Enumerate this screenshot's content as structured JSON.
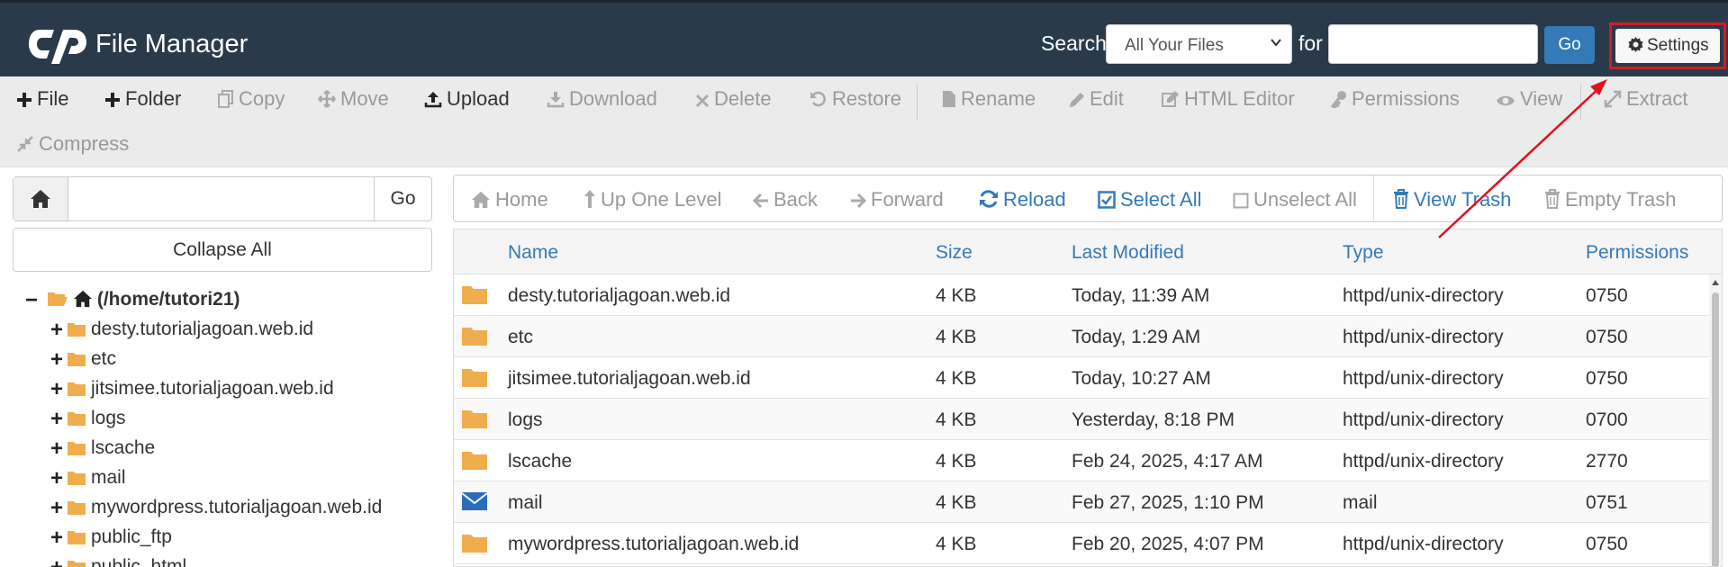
{
  "header": {
    "app_title": "File Manager",
    "search_label": "Search",
    "search_scope": "All Your Files",
    "for_label": "for",
    "search_placeholder": "",
    "go_label": "Go",
    "settings_label": "Settings"
  },
  "toolbar": {
    "row1": [
      {
        "label": "File",
        "icon": "plus-icon",
        "enabled": true
      },
      {
        "label": "Folder",
        "icon": "plus-icon",
        "enabled": true
      },
      {
        "label": "Copy",
        "icon": "copy-icon",
        "enabled": false
      },
      {
        "label": "Move",
        "icon": "move-icon",
        "enabled": false
      },
      {
        "label": "Upload",
        "icon": "upload-icon",
        "enabled": true
      },
      {
        "label": "Download",
        "icon": "download-icon",
        "enabled": false
      },
      {
        "label": "Delete",
        "icon": "close-icon",
        "enabled": false
      },
      {
        "label": "Restore",
        "icon": "undo-icon",
        "enabled": false
      },
      {
        "label": "Rename",
        "icon": "file-icon",
        "enabled": false
      },
      {
        "label": "Edit",
        "icon": "pencil-icon",
        "enabled": false
      },
      {
        "label": "HTML Editor",
        "icon": "pencil-square-icon",
        "enabled": false
      },
      {
        "label": "Permissions",
        "icon": "key-icon",
        "enabled": false
      },
      {
        "label": "View",
        "icon": "eye-icon",
        "enabled": false
      },
      {
        "label": "Extract",
        "icon": "expand-icon",
        "enabled": false
      }
    ],
    "row2": [
      {
        "label": "Compress",
        "icon": "compress-icon",
        "enabled": false
      }
    ]
  },
  "left": {
    "path_value": "",
    "go_label": "Go",
    "collapse_label": "Collapse All",
    "tree_root": "(/home/tutori21)",
    "tree_items": [
      "desty.tutorialjagoan.web.id",
      "etc",
      "jitsimee.tutorialjagoan.web.id",
      "logs",
      "lscache",
      "mail",
      "mywordpress.tutorialjagoan.web.id",
      "public_ftp",
      "public_html"
    ]
  },
  "nav": {
    "items": [
      {
        "label": "Home",
        "icon": "home-icon",
        "blue": false
      },
      {
        "label": "Up One Level",
        "icon": "level-up-icon",
        "blue": false
      },
      {
        "label": "Back",
        "icon": "arrow-left-icon",
        "blue": false
      },
      {
        "label": "Forward",
        "icon": "arrow-right-icon",
        "blue": false
      },
      {
        "label": "Reload",
        "icon": "refresh-icon",
        "blue": true
      },
      {
        "label": "Select All",
        "icon": "check-square-icon",
        "blue": true
      },
      {
        "label": "Unselect All",
        "icon": "square-icon",
        "blue": false
      },
      {
        "label": "View Trash",
        "icon": "trash-icon",
        "blue": true
      },
      {
        "label": "Empty Trash",
        "icon": "trash-icon",
        "blue": false
      }
    ]
  },
  "table": {
    "headers": [
      "Name",
      "Size",
      "Last Modified",
      "Type",
      "Permissions"
    ],
    "rows": [
      {
        "icon": "folder-icon",
        "name": "desty.tutorialjagoan.web.id",
        "size": "4 KB",
        "modified": "Today, 11:39 AM",
        "type": "httpd/unix-directory",
        "perms": "0750"
      },
      {
        "icon": "folder-icon",
        "name": "etc",
        "size": "4 KB",
        "modified": "Today, 1:29 AM",
        "type": "httpd/unix-directory",
        "perms": "0750"
      },
      {
        "icon": "folder-icon",
        "name": "jitsimee.tutorialjagoan.web.id",
        "size": "4 KB",
        "modified": "Today, 10:27 AM",
        "type": "httpd/unix-directory",
        "perms": "0750"
      },
      {
        "icon": "folder-icon",
        "name": "logs",
        "size": "4 KB",
        "modified": "Yesterday, 8:18 PM",
        "type": "httpd/unix-directory",
        "perms": "0700"
      },
      {
        "icon": "folder-icon",
        "name": "lscache",
        "size": "4 KB",
        "modified": "Feb 24, 2025, 4:17 AM",
        "type": "httpd/unix-directory",
        "perms": "2770"
      },
      {
        "icon": "envelope-icon",
        "name": "mail",
        "size": "4 KB",
        "modified": "Feb 27, 2025, 1:10 PM",
        "type": "mail",
        "perms": "0751"
      },
      {
        "icon": "folder-icon",
        "name": "mywordpress.tutorialjagoan.web.id",
        "size": "4 KB",
        "modified": "Feb 20, 2025, 4:07 PM",
        "type": "httpd/unix-directory",
        "perms": "0750"
      }
    ]
  },
  "colors": {
    "header_bg": "#293a4a",
    "link_blue": "#337ab7",
    "folder": "#f0ad4e",
    "mail_icon": "#2a6ebb",
    "highlight": "#d01c24"
  }
}
